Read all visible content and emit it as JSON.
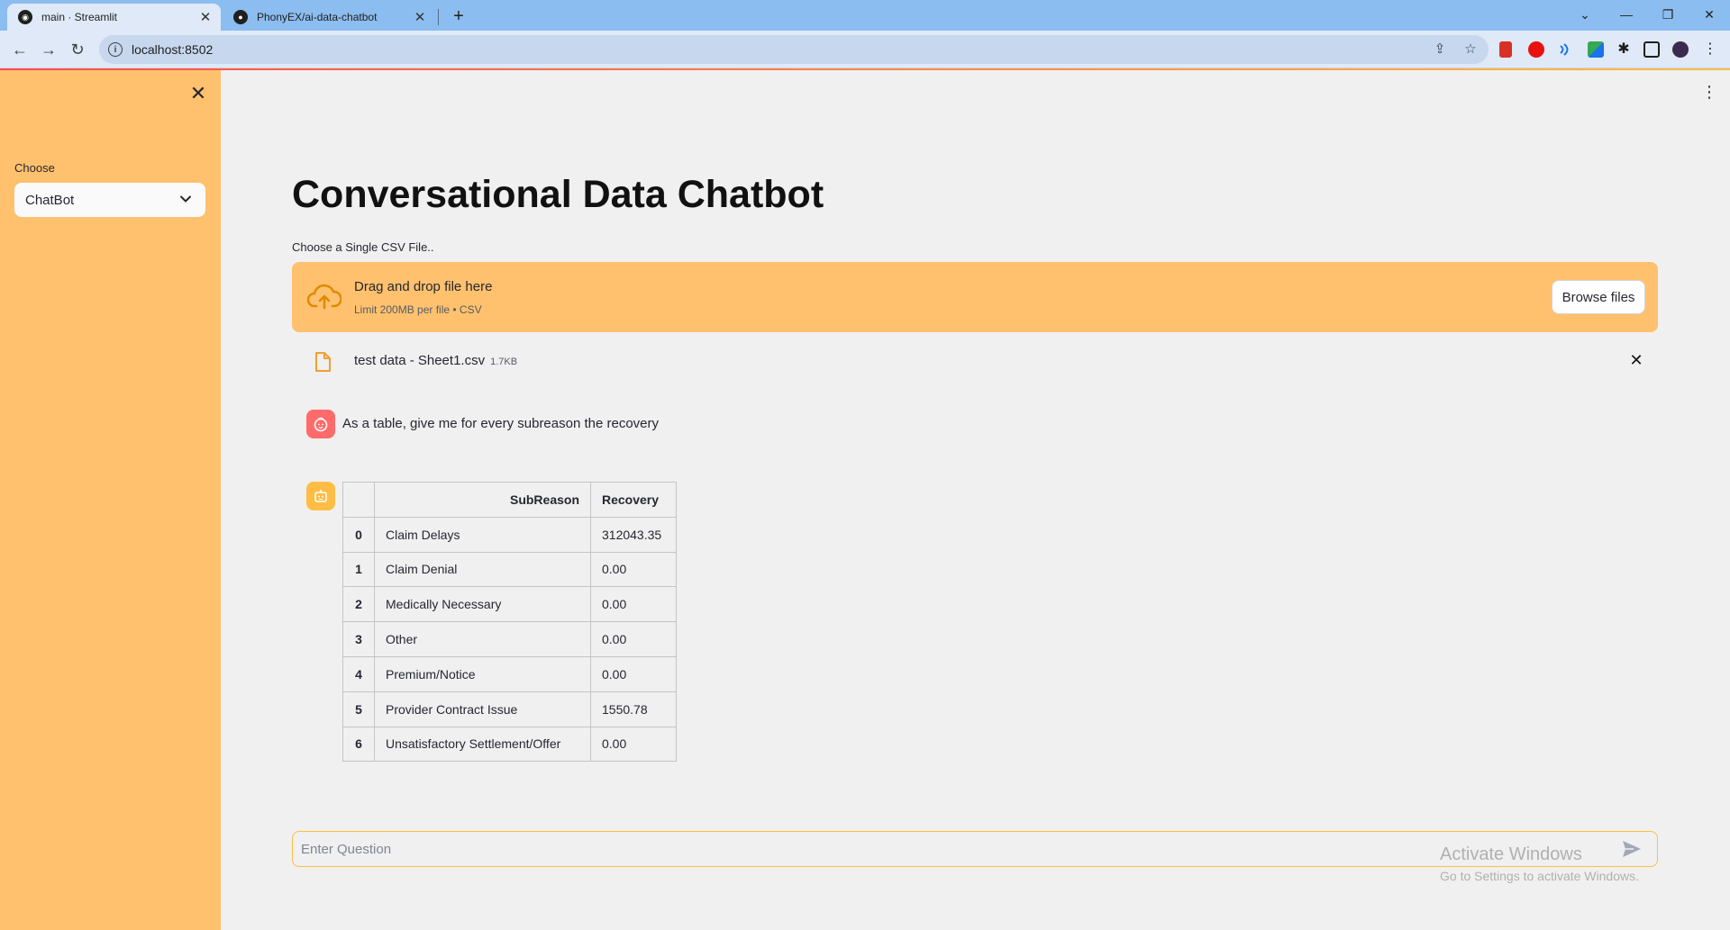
{
  "browser": {
    "tabs": [
      {
        "title": "main · Streamlit",
        "favicon": "streamlit-icon",
        "active": true
      },
      {
        "title": "PhonyEX/ai-data-chatbot",
        "favicon": "github-icon",
        "active": false
      }
    ],
    "tab_close_glyph": "✕",
    "new_tab_glyph": "+",
    "window_controls": {
      "collapse": "⌄",
      "minimize": "—",
      "restore": "❐",
      "close": "✕"
    },
    "url": "localhost:8502",
    "nav": {
      "back": "←",
      "forward": "→",
      "reload": "↻"
    },
    "omni_actions": {
      "share": "⇪",
      "bookmark": "☆"
    },
    "menu_glyph": "⋮"
  },
  "sidebar": {
    "close_glyph": "✕",
    "select_label": "Choose",
    "select_value": "ChatBot"
  },
  "main": {
    "menu_glyph": "⋮",
    "title": "Conversational Data Chatbot",
    "uploader": {
      "label": "Choose a Single CSV File..",
      "drop_text": "Drag and drop file here",
      "limit_text": "Limit 200MB per file • CSV",
      "browse_label": "Browse files"
    },
    "uploaded_file": {
      "name": "test data - Sheet1.csv",
      "size": "1.7KB",
      "remove_glyph": "✕"
    },
    "chat": {
      "user_message": "As a table, give me for every subreason the recovery",
      "table": {
        "columns": [
          "SubReason",
          "Recovery"
        ],
        "rows": [
          {
            "index": "0",
            "subreason": "Claim Delays",
            "recovery": "312043.35"
          },
          {
            "index": "1",
            "subreason": "Claim Denial",
            "recovery": "0.00"
          },
          {
            "index": "2",
            "subreason": "Medically Necessary",
            "recovery": "0.00"
          },
          {
            "index": "3",
            "subreason": "Other",
            "recovery": "0.00"
          },
          {
            "index": "4",
            "subreason": "Premium/Notice",
            "recovery": "0.00"
          },
          {
            "index": "5",
            "subreason": "Provider Contract Issue",
            "recovery": "1550.78"
          },
          {
            "index": "6",
            "subreason": "Unsatisfactory Settlement/Offer",
            "recovery": "0.00"
          }
        ]
      }
    },
    "chat_input": {
      "placeholder": "Enter Question",
      "value": ""
    }
  },
  "watermark": {
    "line1": "Activate Windows",
    "line2": "Go to Settings to activate Windows."
  },
  "colors": {
    "sidebar_bg": "#ffc16e",
    "dropzone_bg": "#ffc16e",
    "accent": "#ffbd45",
    "user_avatar": "#ff6b6b",
    "page_bg": "#f0f0f0",
    "chrome_tabbar": "#8bbdf0"
  }
}
